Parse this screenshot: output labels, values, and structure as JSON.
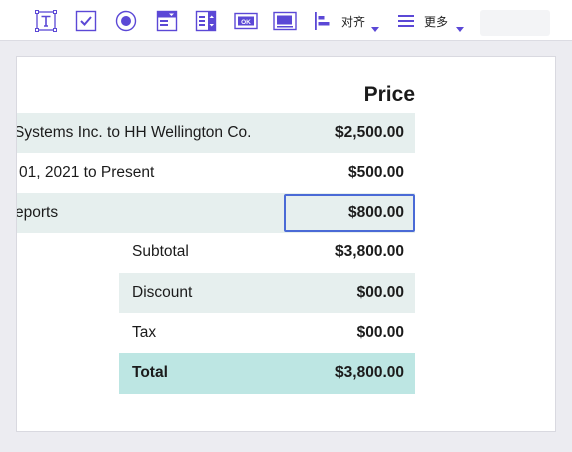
{
  "toolbar": {
    "align_label": "对齐",
    "more_label": "更多",
    "accent_color": "#5b48d6"
  },
  "table": {
    "header_price": "Price",
    "rows": [
      {
        "description": "Systems Inc. to HH Wellington Co.",
        "price": "$2,500.00"
      },
      {
        "description": "01, 2021 to Present",
        "price": "$500.00"
      },
      {
        "description": "eports",
        "price": "$800.00"
      }
    ],
    "summary": [
      {
        "label": "Subtotal",
        "value": "$3,800.00"
      },
      {
        "label": "Discount",
        "value": "$00.00"
      },
      {
        "label": "Tax",
        "value": "$00.00"
      },
      {
        "label": "Total",
        "value": "$3,800.00"
      }
    ],
    "stripe_color": "#e6efee",
    "total_color": "#bde6e3",
    "selection_color": "#4a6ad6"
  }
}
